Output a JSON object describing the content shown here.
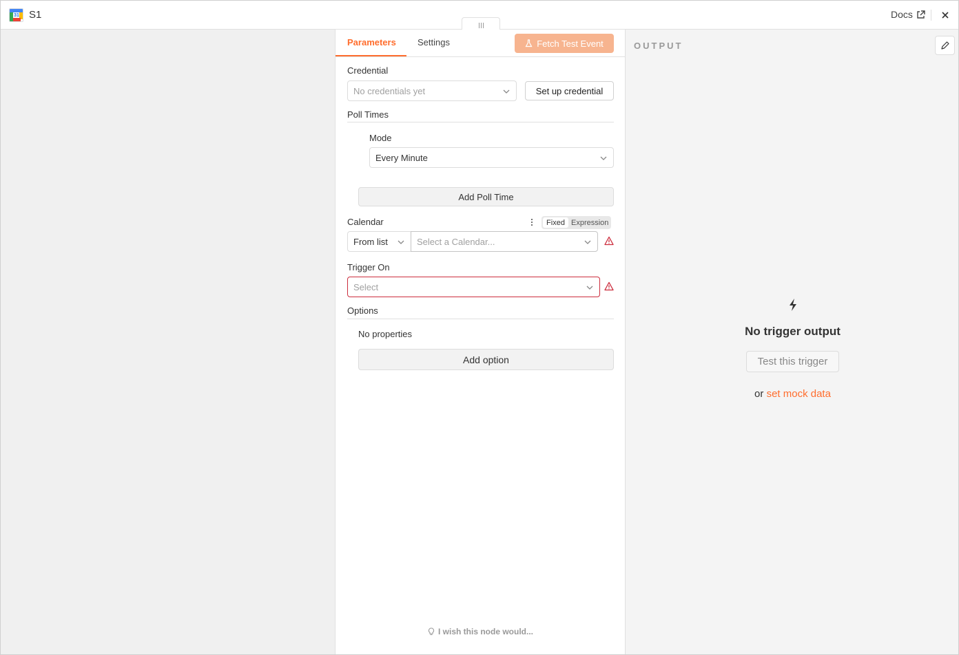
{
  "header": {
    "app_icon": "google-calendar-icon",
    "app_icon_text": "31",
    "title": "S1",
    "docs_label": "Docs",
    "docs_icon": "external-link-icon",
    "close_icon": "close-icon"
  },
  "tabs": {
    "parameters": "Parameters",
    "settings": "Settings",
    "fetch_button": "Fetch Test Event",
    "fetch_icon": "flask-icon"
  },
  "credential": {
    "label": "Credential",
    "placeholder": "No credentials yet",
    "setup_button": "Set up credential"
  },
  "poll_times": {
    "title": "Poll Times",
    "mode_label": "Mode",
    "mode_value": "Every Minute",
    "add_button": "Add Poll Time"
  },
  "calendar": {
    "label": "Calendar",
    "fixed": "Fixed",
    "expression": "Expression",
    "mode_value": "From list",
    "placeholder": "Select a Calendar..."
  },
  "trigger_on": {
    "label": "Trigger On",
    "placeholder": "Select"
  },
  "options": {
    "title": "Options",
    "empty_text": "No properties",
    "add_button": "Add option"
  },
  "feedback": {
    "text": "I wish this node would...",
    "icon": "lightbulb-icon"
  },
  "output": {
    "label": "OUTPUT",
    "edit_icon": "pencil-icon",
    "bolt_icon": "lightning-bolt-icon",
    "empty_title": "No trigger output",
    "test_button": "Test this trigger",
    "or_text": "or",
    "mock_link": "set mock data"
  },
  "colors": {
    "accent": "#ff6d2d",
    "fetch_button_bg": "#f7b48f",
    "error": "#cc2c3c"
  }
}
